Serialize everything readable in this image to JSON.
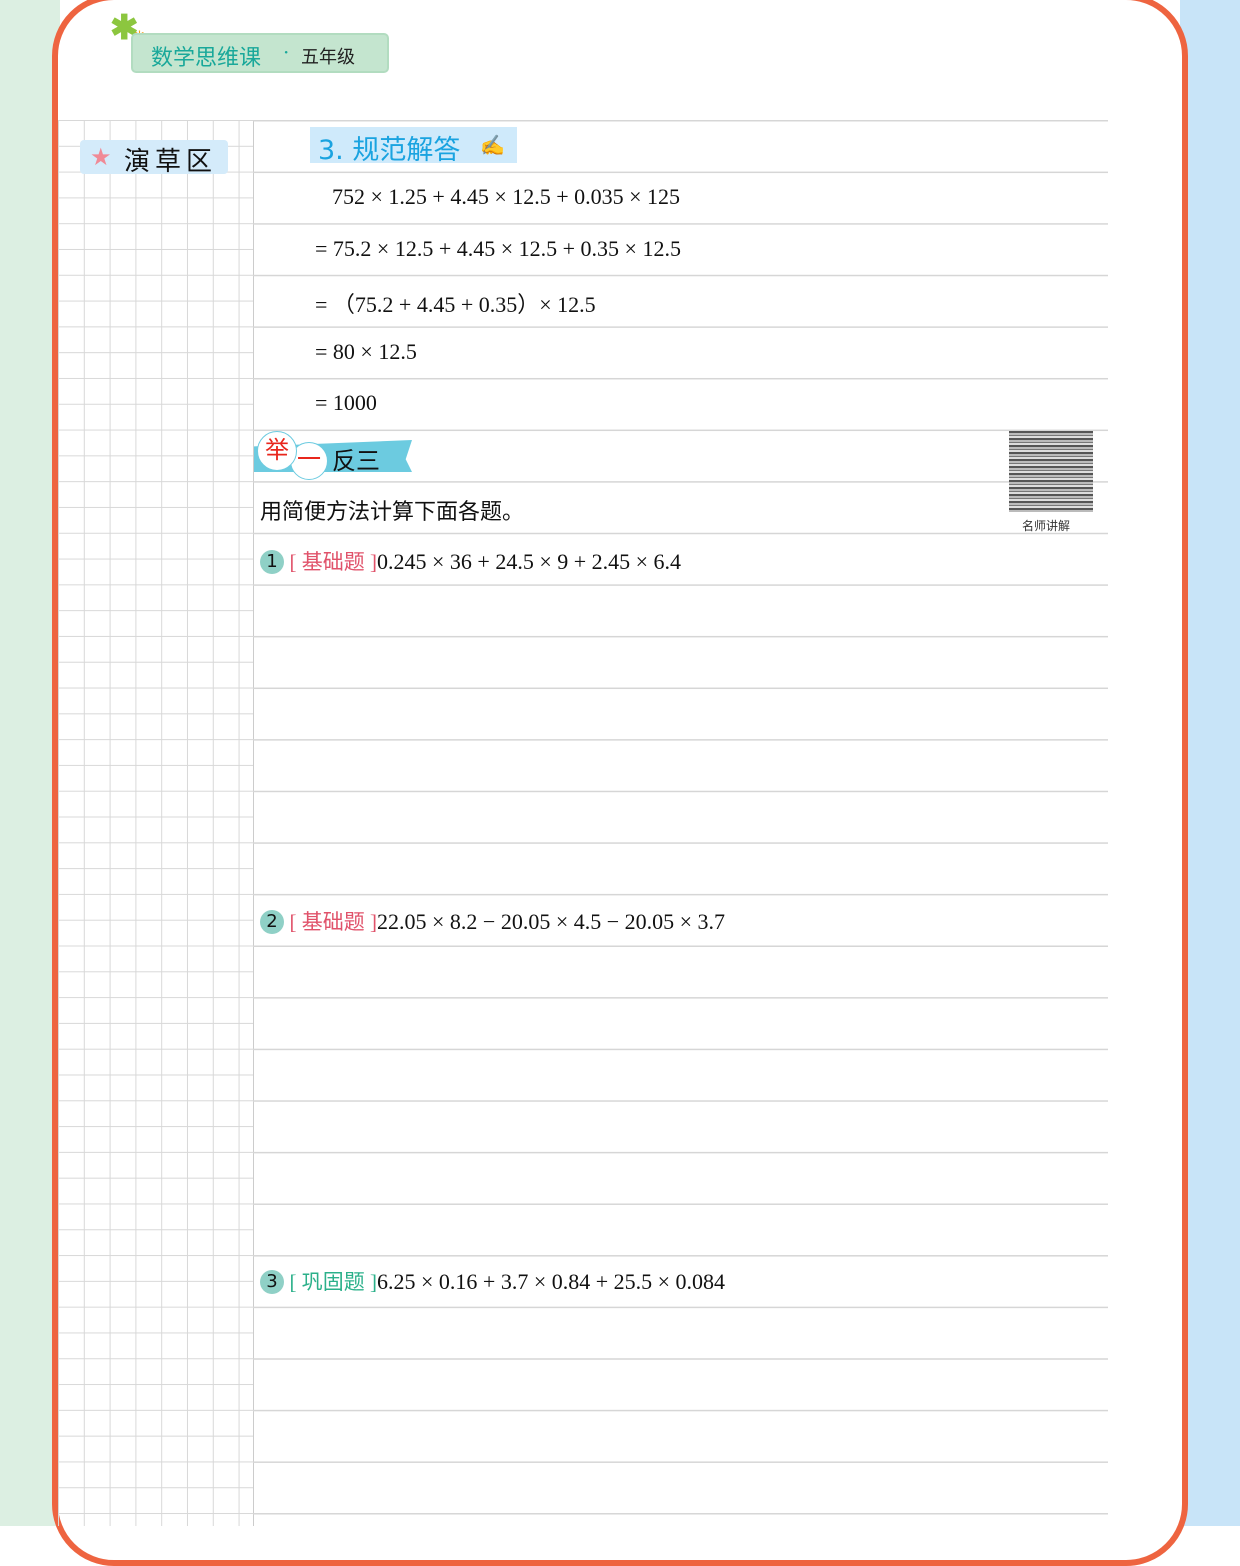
{
  "header": {
    "series": "数学思维课",
    "grade": "五年级"
  },
  "draft_area": {
    "label": "演草区"
  },
  "section": {
    "title": "3. 规范解答",
    "icon": "pen-writing-icon"
  },
  "solution": [
    "752 × 1.25 + 4.45 × 12.5 + 0.035 × 125",
    "= 75.2 × 12.5 + 4.45 × 12.5 + 0.35 × 12.5",
    "= （75.2 + 4.45 + 0.35）× 12.5",
    "= 80 × 12.5",
    "= 1000"
  ],
  "practice": {
    "c1": "举",
    "c2": "一",
    "rest": "反三",
    "instruction": "用简便方法计算下面各题。",
    "qr_caption": "名师讲解"
  },
  "questions": [
    {
      "num": "1",
      "tag": "[ 基础题 ]",
      "expr": "0.245 × 36 + 24.5 × 9 + 2.45 × 6.4",
      "color": "#e0526a"
    },
    {
      "num": "2",
      "tag": "[ 基础题 ]",
      "expr": "22.05 × 8.2 − 20.05 × 4.5 − 20.05 × 3.7",
      "color": "#e0526a"
    },
    {
      "num": "3",
      "tag": "[ 巩固题 ]",
      "expr": "6.25 × 0.16 + 3.7 × 0.84 + 25.5 × 0.084",
      "color": "#2bb08a"
    }
  ]
}
